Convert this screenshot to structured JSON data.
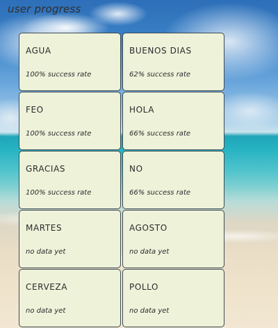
{
  "header": {
    "title": "user progress"
  },
  "colors": {
    "card_background": "#edf2d9",
    "card_border": "#3e4a52",
    "text": "#2b2b2b"
  },
  "cards": [
    {
      "word": "AGUA",
      "stat": "100% success rate"
    },
    {
      "word": "BUENOS DIAS",
      "stat": "62% success rate"
    },
    {
      "word": "FEO",
      "stat": "100% success rate"
    },
    {
      "word": "HOLA",
      "stat": "66% success rate"
    },
    {
      "word": "GRACIAS",
      "stat": "100% success rate"
    },
    {
      "word": "NO",
      "stat": "66% success rate"
    },
    {
      "word": "MARTES",
      "stat": "no data yet"
    },
    {
      "word": "AGOSTO",
      "stat": "no data yet"
    },
    {
      "word": "CERVEZA",
      "stat": "no data yet"
    },
    {
      "word": "POLLO",
      "stat": "no data yet"
    }
  ]
}
